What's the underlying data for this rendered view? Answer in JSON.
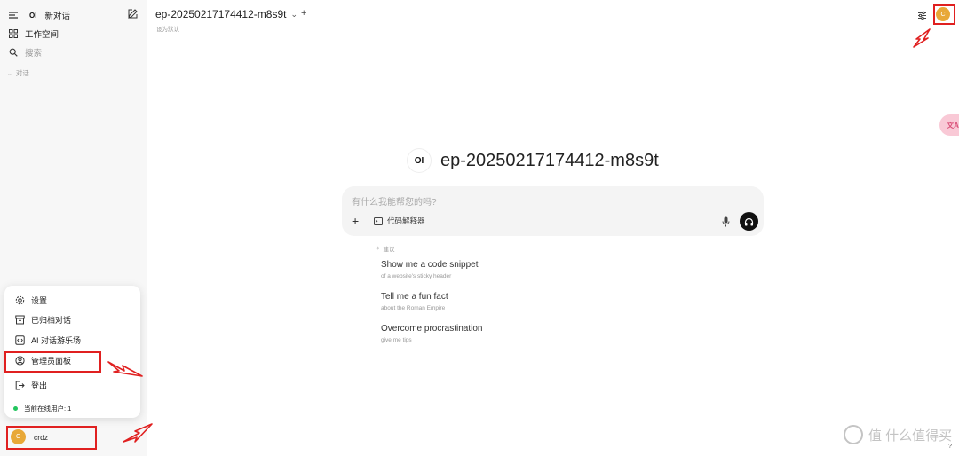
{
  "sidebar": {
    "new_chat_label": "新对话",
    "workspace_label": "工作空间",
    "search_placeholder": "搜索",
    "chats_section_label": "对话",
    "logo_text": "OI"
  },
  "user_menu": {
    "items": [
      {
        "label": "设置",
        "icon": "gear-icon"
      },
      {
        "label": "已归档对话",
        "icon": "archive-icon"
      },
      {
        "label": "AI 对话游乐场",
        "icon": "code-icon"
      },
      {
        "label": "管理员面板",
        "icon": "user-circle-icon"
      },
      {
        "label": "登出",
        "icon": "logout-icon"
      }
    ],
    "online_users_label": "当前在线用户: 1"
  },
  "user": {
    "name": "crdz",
    "avatar_letter": "C"
  },
  "header": {
    "model_name": "ep-20250217174412-m8s9t",
    "set_default_label": "设为默认",
    "add_label": "+"
  },
  "main": {
    "logo_text": "OI",
    "model_title": "ep-20250217174412-m8s9t",
    "prompt_placeholder": "有什么我能帮您的吗?",
    "code_interpreter_label": "代码解释器",
    "suggestions_label": "建议",
    "suggestions": [
      {
        "title": "Show me a code snippet",
        "subtitle": "of a website's sticky header"
      },
      {
        "title": "Tell me a fun fact",
        "subtitle": "about the Roman Empire"
      },
      {
        "title": "Overcome procrastination",
        "subtitle": "give me tips"
      }
    ]
  },
  "watermark": "值 什么值得买",
  "help_label": "?",
  "colors": {
    "highlight_red": "#e02020",
    "avatar_orange": "#e8a838",
    "online_green": "#22c55e"
  }
}
